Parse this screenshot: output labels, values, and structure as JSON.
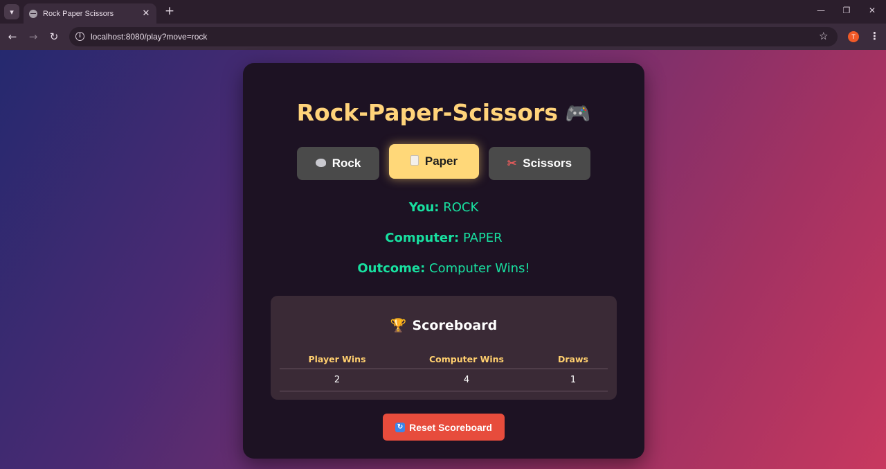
{
  "browser": {
    "tab_title": "Rock Paper Scissors",
    "tab_close": "✕",
    "new_tab": "+",
    "url": "localhost:8080/play?move=rock",
    "profile_initial": "T"
  },
  "game": {
    "title": "Rock-Paper-Scissors",
    "title_icon": "gamepad-icon",
    "moves": [
      {
        "label": "Rock",
        "icon": "rock-icon",
        "selected": false
      },
      {
        "label": "Paper",
        "icon": "paper-icon",
        "selected": true
      },
      {
        "label": "Scissors",
        "icon": "scissors-icon",
        "selected": false
      }
    ],
    "result": {
      "you_label": "You:",
      "you_value": "ROCK",
      "computer_label": "Computer:",
      "computer_value": "PAPER",
      "outcome_label": "Outcome:",
      "outcome_value": "Computer Wins!"
    },
    "scoreboard": {
      "title": "Scoreboard",
      "icon": "trophy-icon",
      "headers": [
        "Player Wins",
        "Computer Wins",
        "Draws"
      ],
      "values": [
        "2",
        "4",
        "1"
      ]
    },
    "reset_label": "Reset Scoreboard"
  },
  "colors": {
    "accent_yellow": "#ffd879",
    "result_green": "#18e0a0",
    "reset_red": "#e74c3c",
    "card_bg": "#1d1223"
  }
}
